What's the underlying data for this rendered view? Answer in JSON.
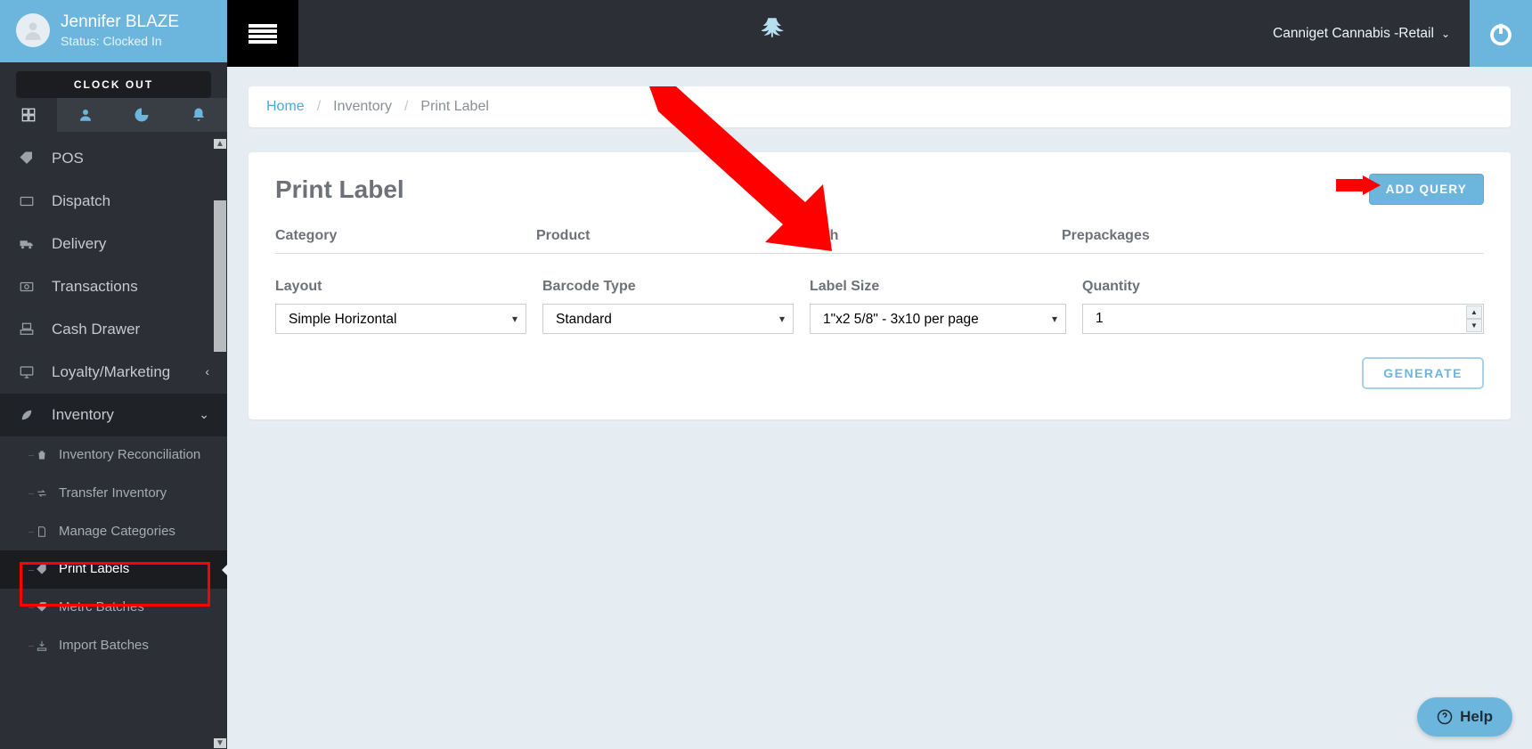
{
  "user": {
    "name": "Jennifer BLAZE",
    "status": "Status: Clocked In"
  },
  "clock_out": "CLOCK OUT",
  "company": "Canniget Cannabis -Retail",
  "nav": {
    "pos": "POS",
    "dispatch": "Dispatch",
    "delivery": "Delivery",
    "transactions": "Transactions",
    "cash_drawer": "Cash Drawer",
    "loyalty": "Loyalty/Marketing",
    "inventory": "Inventory"
  },
  "subnav": {
    "recon": "Inventory Reconciliation",
    "transfer": "Transfer Inventory",
    "categories": "Manage Categories",
    "print_labels": "Print Labels",
    "metrc": "Metrc Batches",
    "import": "Import Batches"
  },
  "breadcrumb": {
    "home": "Home",
    "inventory": "Inventory",
    "print_label": "Print Label"
  },
  "panel": {
    "title": "Print Label",
    "add_query": "ADD QUERY",
    "cols": {
      "category": "Category",
      "product": "Product",
      "batch": "Batch",
      "prepackages": "Prepackages"
    },
    "form": {
      "layout_label": "Layout",
      "layout_value": "Simple Horizontal",
      "barcode_label": "Barcode Type",
      "barcode_value": "Standard",
      "size_label": "Label Size",
      "size_value": "1\"x2 5/8\" - 3x10 per page",
      "qty_label": "Quantity",
      "qty_value": "1"
    },
    "generate": "GENERATE"
  },
  "help": "Help"
}
